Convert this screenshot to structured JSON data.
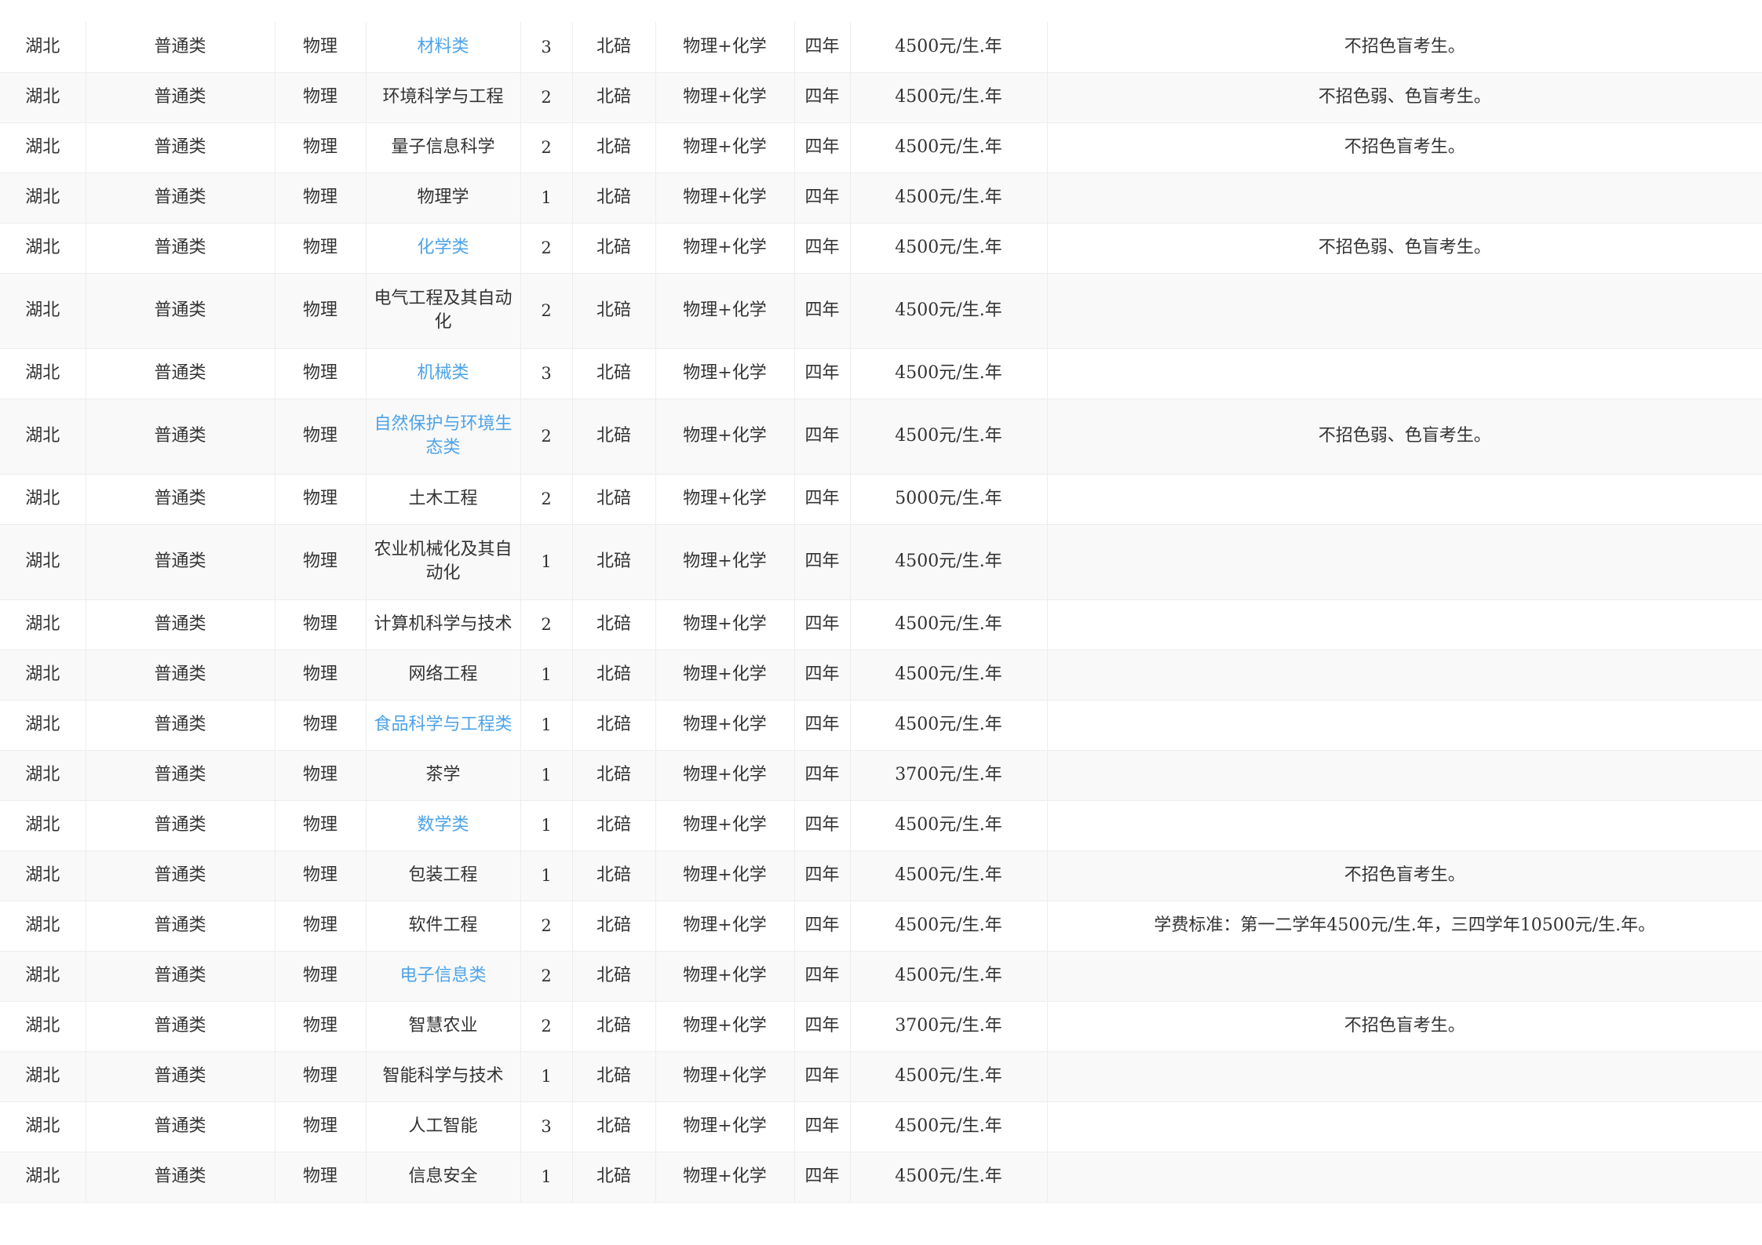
{
  "table": {
    "rows": [
      {
        "province": "湖北",
        "batch": "普通类",
        "subject": "物理",
        "major": "材料类",
        "major_link": true,
        "plan": "3",
        "campus": "北碚",
        "requirement": "物理+化学",
        "duration": "四年",
        "tuition": "4500元/生.年",
        "note": "不招色盲考生。"
      },
      {
        "province": "湖北",
        "batch": "普通类",
        "subject": "物理",
        "major": "环境科学与工程",
        "major_link": false,
        "plan": "2",
        "campus": "北碚",
        "requirement": "物理+化学",
        "duration": "四年",
        "tuition": "4500元/生.年",
        "note": "不招色弱、色盲考生。"
      },
      {
        "province": "湖北",
        "batch": "普通类",
        "subject": "物理",
        "major": "量子信息科学",
        "major_link": false,
        "plan": "2",
        "campus": "北碚",
        "requirement": "物理+化学",
        "duration": "四年",
        "tuition": "4500元/生.年",
        "note": "不招色盲考生。"
      },
      {
        "province": "湖北",
        "batch": "普通类",
        "subject": "物理",
        "major": "物理学",
        "major_link": false,
        "plan": "1",
        "campus": "北碚",
        "requirement": "物理+化学",
        "duration": "四年",
        "tuition": "4500元/生.年",
        "note": ""
      },
      {
        "province": "湖北",
        "batch": "普通类",
        "subject": "物理",
        "major": "化学类",
        "major_link": true,
        "plan": "2",
        "campus": "北碚",
        "requirement": "物理+化学",
        "duration": "四年",
        "tuition": "4500元/生.年",
        "note": "不招色弱、色盲考生。"
      },
      {
        "province": "湖北",
        "batch": "普通类",
        "subject": "物理",
        "major": "电气工程及其自动化",
        "major_link": false,
        "plan": "2",
        "campus": "北碚",
        "requirement": "物理+化学",
        "duration": "四年",
        "tuition": "4500元/生.年",
        "note": ""
      },
      {
        "province": "湖北",
        "batch": "普通类",
        "subject": "物理",
        "major": "机械类",
        "major_link": true,
        "plan": "3",
        "campus": "北碚",
        "requirement": "物理+化学",
        "duration": "四年",
        "tuition": "4500元/生.年",
        "note": ""
      },
      {
        "province": "湖北",
        "batch": "普通类",
        "subject": "物理",
        "major": "自然保护与环境生态类",
        "major_link": true,
        "plan": "2",
        "campus": "北碚",
        "requirement": "物理+化学",
        "duration": "四年",
        "tuition": "4500元/生.年",
        "note": "不招色弱、色盲考生。"
      },
      {
        "province": "湖北",
        "batch": "普通类",
        "subject": "物理",
        "major": "土木工程",
        "major_link": false,
        "plan": "2",
        "campus": "北碚",
        "requirement": "物理+化学",
        "duration": "四年",
        "tuition": "5000元/生.年",
        "note": ""
      },
      {
        "province": "湖北",
        "batch": "普通类",
        "subject": "物理",
        "major": "农业机械化及其自动化",
        "major_link": false,
        "plan": "1",
        "campus": "北碚",
        "requirement": "物理+化学",
        "duration": "四年",
        "tuition": "4500元/生.年",
        "note": ""
      },
      {
        "province": "湖北",
        "batch": "普通类",
        "subject": "物理",
        "major": "计算机科学与技术",
        "major_link": false,
        "plan": "2",
        "campus": "北碚",
        "requirement": "物理+化学",
        "duration": "四年",
        "tuition": "4500元/生.年",
        "note": ""
      },
      {
        "province": "湖北",
        "batch": "普通类",
        "subject": "物理",
        "major": "网络工程",
        "major_link": false,
        "plan": "1",
        "campus": "北碚",
        "requirement": "物理+化学",
        "duration": "四年",
        "tuition": "4500元/生.年",
        "note": ""
      },
      {
        "province": "湖北",
        "batch": "普通类",
        "subject": "物理",
        "major": "食品科学与工程类",
        "major_link": true,
        "plan": "1",
        "campus": "北碚",
        "requirement": "物理+化学",
        "duration": "四年",
        "tuition": "4500元/生.年",
        "note": ""
      },
      {
        "province": "湖北",
        "batch": "普通类",
        "subject": "物理",
        "major": "茶学",
        "major_link": false,
        "plan": "1",
        "campus": "北碚",
        "requirement": "物理+化学",
        "duration": "四年",
        "tuition": "3700元/生.年",
        "note": ""
      },
      {
        "province": "湖北",
        "batch": "普通类",
        "subject": "物理",
        "major": "数学类",
        "major_link": true,
        "plan": "1",
        "campus": "北碚",
        "requirement": "物理+化学",
        "duration": "四年",
        "tuition": "4500元/生.年",
        "note": ""
      },
      {
        "province": "湖北",
        "batch": "普通类",
        "subject": "物理",
        "major": "包装工程",
        "major_link": false,
        "plan": "1",
        "campus": "北碚",
        "requirement": "物理+化学",
        "duration": "四年",
        "tuition": "4500元/生.年",
        "note": "不招色盲考生。"
      },
      {
        "province": "湖北",
        "batch": "普通类",
        "subject": "物理",
        "major": "软件工程",
        "major_link": false,
        "plan": "2",
        "campus": "北碚",
        "requirement": "物理+化学",
        "duration": "四年",
        "tuition": "4500元/生.年",
        "note": "学费标准：第一二学年4500元/生.年，三四学年10500元/生.年。"
      },
      {
        "province": "湖北",
        "batch": "普通类",
        "subject": "物理",
        "major": "电子信息类",
        "major_link": true,
        "plan": "2",
        "campus": "北碚",
        "requirement": "物理+化学",
        "duration": "四年",
        "tuition": "4500元/生.年",
        "note": ""
      },
      {
        "province": "湖北",
        "batch": "普通类",
        "subject": "物理",
        "major": "智慧农业",
        "major_link": false,
        "plan": "2",
        "campus": "北碚",
        "requirement": "物理+化学",
        "duration": "四年",
        "tuition": "3700元/生.年",
        "note": "不招色盲考生。"
      },
      {
        "province": "湖北",
        "batch": "普通类",
        "subject": "物理",
        "major": "智能科学与技术",
        "major_link": false,
        "plan": "1",
        "campus": "北碚",
        "requirement": "物理+化学",
        "duration": "四年",
        "tuition": "4500元/生.年",
        "note": ""
      },
      {
        "province": "湖北",
        "batch": "普通类",
        "subject": "物理",
        "major": "人工智能",
        "major_link": false,
        "plan": "3",
        "campus": "北碚",
        "requirement": "物理+化学",
        "duration": "四年",
        "tuition": "4500元/生.年",
        "note": ""
      },
      {
        "province": "湖北",
        "batch": "普通类",
        "subject": "物理",
        "major": "信息安全",
        "major_link": false,
        "plan": "1",
        "campus": "北碚",
        "requirement": "物理+化学",
        "duration": "四年",
        "tuition": "4500元/生.年",
        "note": ""
      }
    ],
    "colors": {
      "link": "#4da3e8",
      "text": "#333333",
      "stripe": "#f9f9f9",
      "border": "#ededed"
    }
  }
}
